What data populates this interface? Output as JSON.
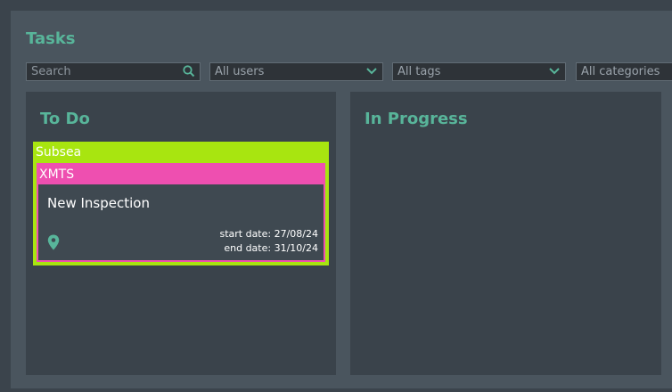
{
  "header": {
    "title": "Tasks"
  },
  "filters": {
    "search_placeholder": "Search",
    "users_value": "All users",
    "tags_value": "All tags",
    "categories_value": "All categories"
  },
  "columns": [
    {
      "title": "To Do"
    },
    {
      "title": "In Progress"
    }
  ],
  "card": {
    "category": "Subsea",
    "tag": "XMTS",
    "title": "New Inspection",
    "start_date": "start date: 27/08/24",
    "end_date": "end date: 31/10/24",
    "location_text": "",
    "icons": [
      "map-pin-icon"
    ]
  },
  "colors": {
    "accent": "#58b59a",
    "category_color": "#a8e510",
    "tag_color": "#ee4fb0",
    "background": "#3b444c",
    "panel": "#4a555e",
    "column": "#3a434b"
  }
}
